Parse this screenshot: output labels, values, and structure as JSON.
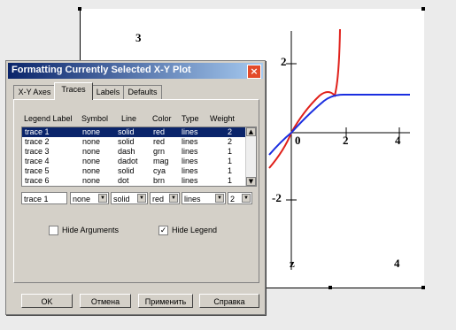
{
  "plot": {
    "top_left_value": "3",
    "bottom_left_label": "z",
    "bottom_right_value": "4",
    "y_tick_labels": [
      "2",
      "-2"
    ],
    "x_tick_labels": [
      "0",
      "2",
      "4"
    ],
    "colors": {
      "trace_red": "#e0201a",
      "trace_blue": "#1a2ee0"
    }
  },
  "dialog": {
    "title": "Formatting Currently Selected X-Y Plot",
    "tabs": [
      "X-Y Axes",
      "Traces",
      "Labels",
      "Defaults"
    ],
    "columns": [
      "Legend Label",
      "Symbol",
      "Line",
      "Color",
      "Type",
      "Weight"
    ],
    "rows": [
      [
        "trace 1",
        "none",
        "solid",
        "red",
        "lines",
        "2"
      ],
      [
        "trace 2",
        "none",
        "solid",
        "red",
        "lines",
        "2"
      ],
      [
        "trace 3",
        "none",
        "dash",
        "grn",
        "lines",
        "1"
      ],
      [
        "trace 4",
        "none",
        "dadot",
        "mag",
        "lines",
        "1"
      ],
      [
        "trace 5",
        "none",
        "solid",
        "cya",
        "lines",
        "1"
      ],
      [
        "trace 6",
        "none",
        "dot",
        "brn",
        "lines",
        "1"
      ]
    ],
    "edit": {
      "label": "trace 1",
      "symbol": "none",
      "line": "solid",
      "color": "red",
      "type": "lines",
      "weight": "2"
    },
    "hide_arguments": "Hide Arguments",
    "hide_legend": "Hide Legend",
    "buttons": {
      "ok": "OK",
      "cancel": "Отмена",
      "apply": "Применить",
      "help": "Справка"
    }
  }
}
